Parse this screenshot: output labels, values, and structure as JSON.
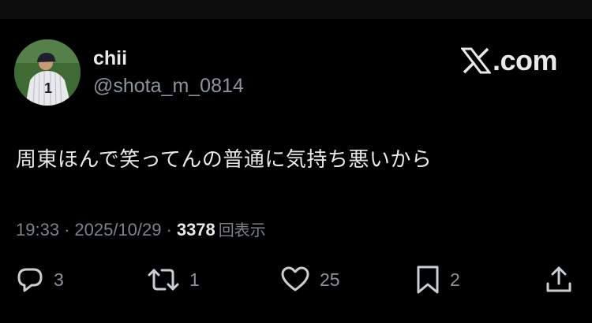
{
  "user": {
    "display_name": "chii",
    "handle": "@shota_m_0814"
  },
  "brand": {
    "text": ".com"
  },
  "tweet": {
    "text": "周東ほんで笑ってんの普通に気持ち悪いから"
  },
  "meta": {
    "time": "19:33",
    "separator": "·",
    "date": "2025/10/29",
    "views": "3378",
    "views_label": "回表示"
  },
  "actions": {
    "reply_count": "3",
    "repost_count": "1",
    "like_count": "25",
    "bookmark_count": "2"
  },
  "colors": {
    "background": "#000000",
    "text": "#e7e9ea",
    "secondary": "#8b949e"
  }
}
